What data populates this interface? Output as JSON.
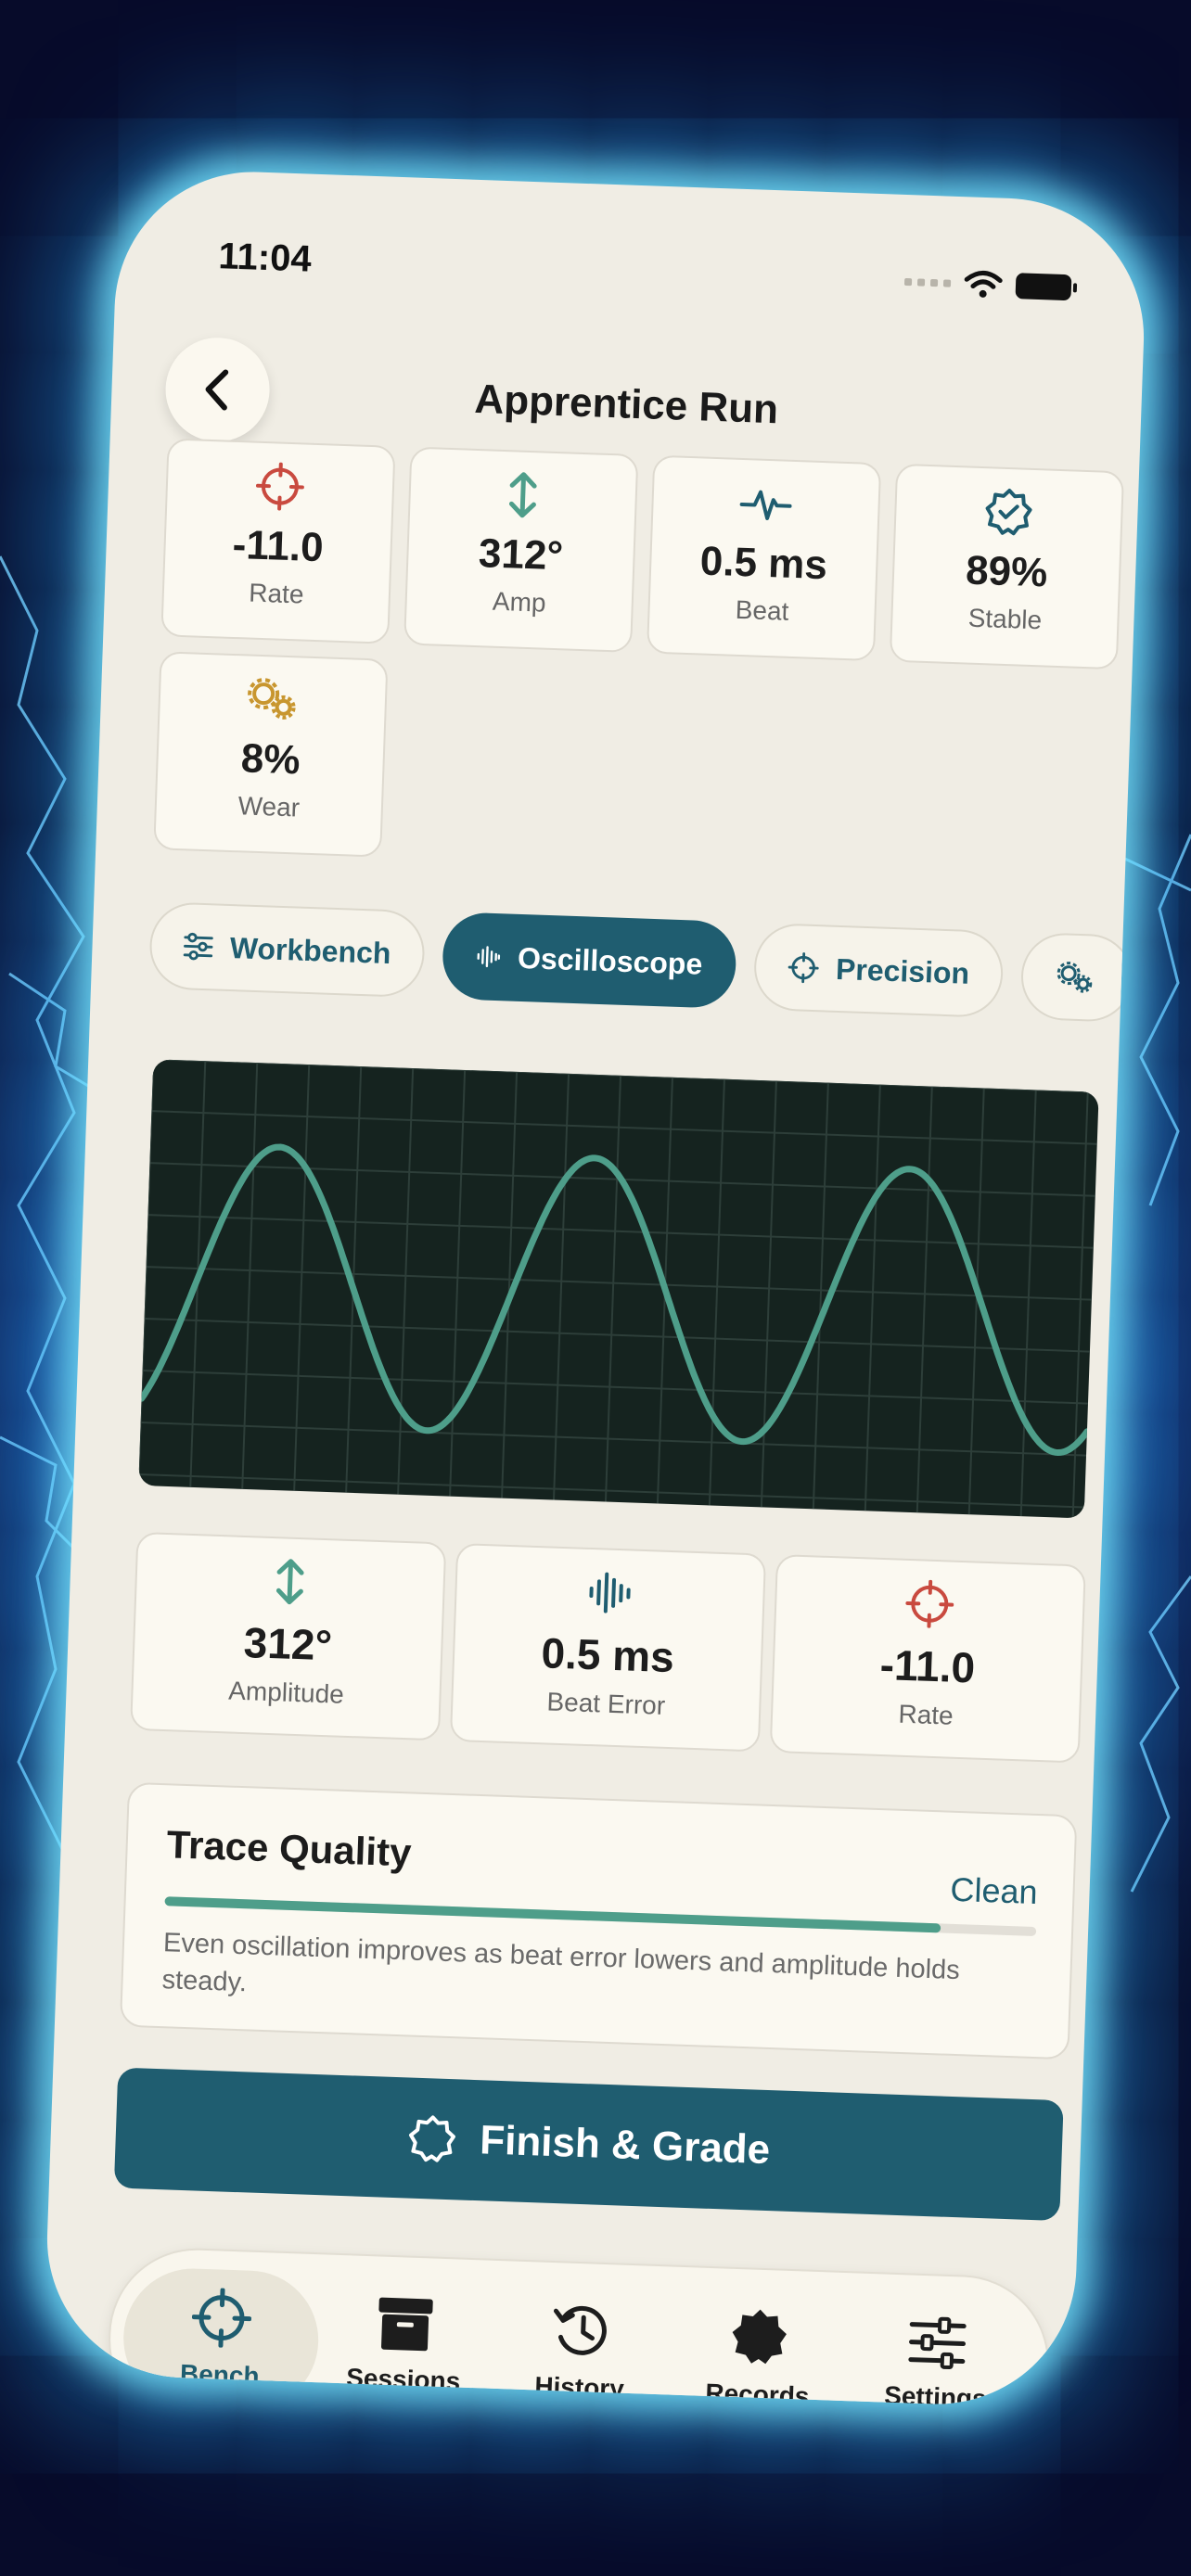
{
  "status_bar": {
    "time": "11:04"
  },
  "header": {
    "title": "Apprentice Run",
    "back_icon": "chevron-left-icon"
  },
  "metrics": [
    {
      "value": "-11.0",
      "label": "Rate",
      "icon": "crosshair-icon",
      "color": "#c94a3f"
    },
    {
      "value": "312°",
      "label": "Amp",
      "icon": "vertical-arrows-icon",
      "color": "#4e9e8a"
    },
    {
      "value": "0.5 ms",
      "label": "Beat",
      "icon": "pulse-icon",
      "color": "#1f5d70"
    },
    {
      "value": "89%",
      "label": "Stable",
      "icon": "verified-badge-icon",
      "color": "#1f5d70"
    },
    {
      "value": "8%",
      "label": "Wear",
      "icon": "gears-icon",
      "color": "#c8962f"
    }
  ],
  "tabs": [
    {
      "label": "Workbench",
      "icon": "sliders-icon",
      "active": false
    },
    {
      "label": "Oscilloscope",
      "icon": "waveform-icon",
      "active": true
    },
    {
      "label": "Precision",
      "icon": "crosshair-icon",
      "active": false
    },
    {
      "label": "",
      "icon": "gears-icon",
      "active": false
    }
  ],
  "readouts": [
    {
      "value": "312°",
      "label": "Amplitude",
      "icon": "vertical-arrows-icon",
      "color": "#4e9e8a"
    },
    {
      "value": "0.5 ms",
      "label": "Beat Error",
      "icon": "waveform-icon",
      "color": "#1f5d70"
    },
    {
      "value": "-11.0",
      "label": "Rate",
      "icon": "crosshair-icon",
      "color": "#c94a3f"
    }
  ],
  "quality": {
    "title": "Trace Quality",
    "status": "Clean",
    "level": 0.89,
    "description": "Even oscillation improves as beat error lowers and amplitude holds steady."
  },
  "finish_button": {
    "label": "Finish & Grade",
    "icon": "badge-outline-icon"
  },
  "nav": [
    {
      "label": "Bench",
      "icon": "crosshair-icon",
      "active": true
    },
    {
      "label": "Sessions",
      "icon": "archive-box-icon",
      "active": false
    },
    {
      "label": "History",
      "icon": "history-clock-icon",
      "active": false
    },
    {
      "label": "Records",
      "icon": "seal-badge-icon",
      "active": false
    },
    {
      "label": "Settings",
      "icon": "sliders-icon",
      "active": false
    }
  ],
  "colors": {
    "accent": "#1f5d70",
    "trace": "#4e9e8a",
    "background": "#f0ede4",
    "scope": "#15231f"
  }
}
